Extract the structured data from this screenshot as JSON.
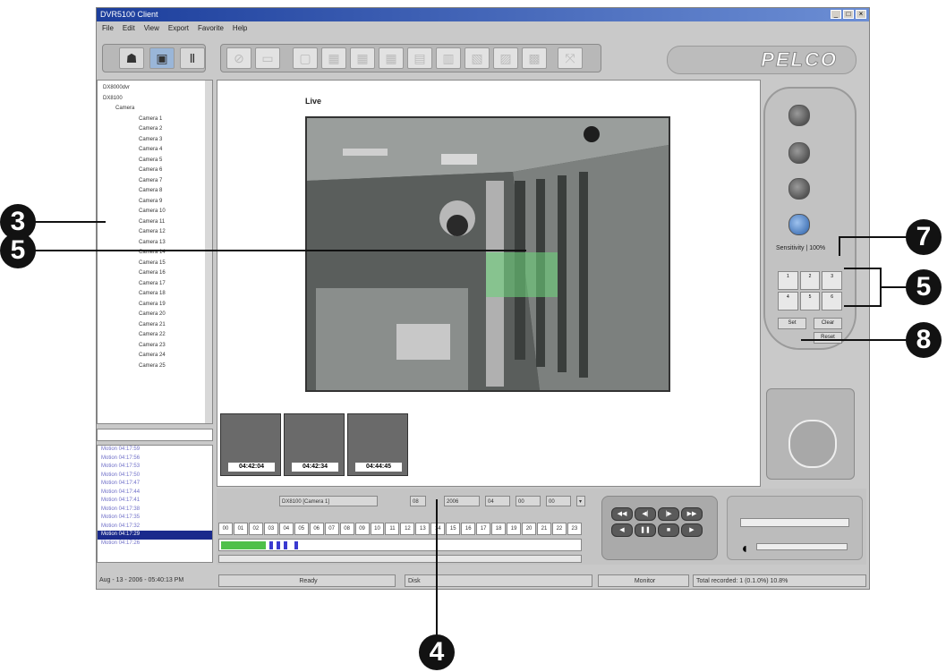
{
  "window": {
    "title": "DVR5100 Client",
    "controls": [
      "_",
      "□",
      "×"
    ]
  },
  "menu": [
    "File",
    "Edit",
    "View",
    "Export",
    "Favorite",
    "Help"
  ],
  "brand": "PELCO",
  "tree": {
    "nodes": [
      "DX8000dvr",
      "DX8100",
      "Camera",
      "Camera 1",
      "Camera 2",
      "Camera 3",
      "Camera 4",
      "Camera 5",
      "Camera 6",
      "Camera 7",
      "Camera 8",
      "Camera 9",
      "Camera 10",
      "Camera 11",
      "Camera 12",
      "Camera 13",
      "Camera 14",
      "Camera 15",
      "Camera 16",
      "Camera 17",
      "Camera 18",
      "Camera 19",
      "Camera 20",
      "Camera 21",
      "Camera 22",
      "Camera 23",
      "Camera 24",
      "Camera 25"
    ]
  },
  "log": {
    "items": [
      "Motion 04:17:59",
      "Motion 04:17:56",
      "Motion 04:17:53",
      "Motion 04:17:50",
      "Motion 04:17:47",
      "Motion 04:17:44",
      "Motion 04:17:41",
      "Motion 04:17:38",
      "Motion 04:17:35",
      "Motion 04:17:32",
      "Motion 04:17:29",
      "Motion 04:17:26"
    ],
    "selected_index": 10
  },
  "viewer": {
    "label": "Live"
  },
  "thumbnails": [
    {
      "time": "04:42:04"
    },
    {
      "time": "04:42:34"
    },
    {
      "time": "04:44:45"
    }
  ],
  "controls": {
    "sensitivity": "Sensitivity | 100%",
    "presets": [
      "1",
      "2",
      "3",
      "4",
      "5",
      "6"
    ],
    "btn_left": "Set",
    "btn_right": "Clear",
    "btn_bottom": "Reset"
  },
  "bottom": {
    "camera_field": "DX8100 [Camera 1]",
    "date_day": "08",
    "date_year": "2006",
    "hour": "04",
    "minute": "00",
    "second": "00",
    "hours": [
      "00",
      "01",
      "02",
      "03",
      "04",
      "05",
      "06",
      "07",
      "08",
      "09",
      "10",
      "11",
      "12",
      "13",
      "14",
      "15",
      "16",
      "17",
      "18",
      "19",
      "20",
      "21",
      "22",
      "23"
    ]
  },
  "status": {
    "datetime": "Aug - 13 - 2006 - 05:40:13 PM",
    "state": "Ready",
    "disk": "Disk",
    "mode": "Monitor",
    "total": "Total recorded: 1 (0.1.0%) 10.8%"
  },
  "callouts": [
    "3",
    "5",
    "4",
    "7",
    "5",
    "8"
  ]
}
